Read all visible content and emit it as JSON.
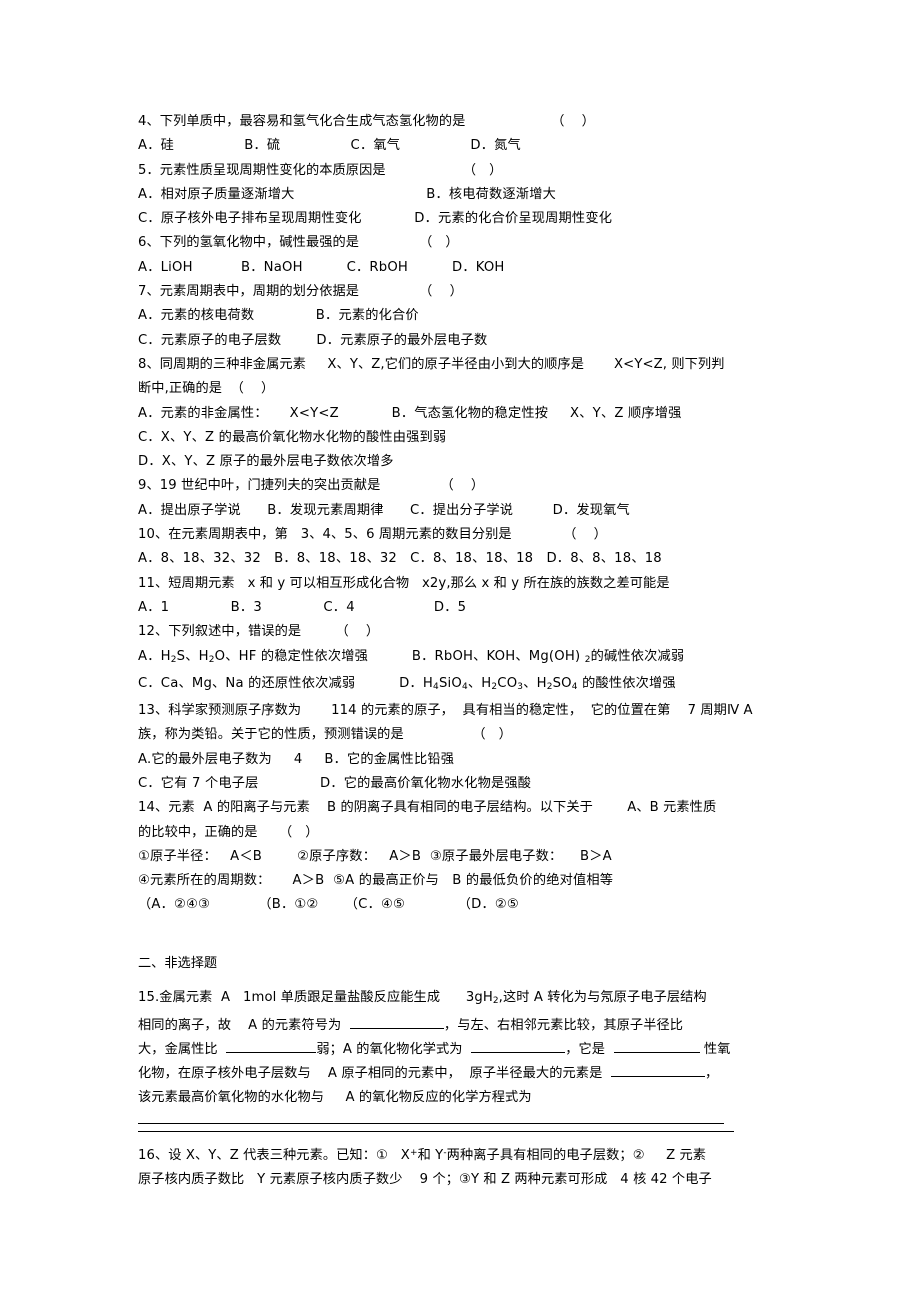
{
  "document": {
    "section_two_heading": "二、非选择题",
    "questions": [
      {
        "id": "q4",
        "stem": "4、下列单质中，最容易和氢气化合生成气态氢化物的是                    （    ）",
        "options": "A．硅                B．硫                C．氧气                D．氮气"
      },
      {
        "id": "q5",
        "stem": "5．元素性质呈现周期性变化的本质原因是                  （   ）",
        "option_a": "A．相对原子质量逐渐增大                              B．核电荷数逐渐增大",
        "option_c": "C．原子核外电子排布呈现周期性变化            D．元素的化合价呈现周期性变化"
      },
      {
        "id": "q6",
        "stem": "6、下列的氢氧化物中，碱性最强的是              （   ）",
        "options": "A．LiOH           B．NaOH          C．RbOH          D．KOH"
      },
      {
        "id": "q7",
        "stem": "7、元素周期表中，周期的划分依据是              （    ）",
        "option_a": "A．元素的核电荷数              B．元素的化合价",
        "option_c": "C．元素原子的电子层数        D．元素原子的最外层电子数"
      },
      {
        "id": "q8",
        "stem_line1": "8、同周期的三种非金属元素     X、Y、Z,它们的原子半径由小到大的顺序是       X<Y<Z, 则下列判",
        "stem_line2": "断中,正确的是  （    ）",
        "option_a": "A．元素的非金属性：     X<Y<Z            B．气态氢化物的稳定性按     X、Y、Z 顺序增强",
        "option_c": "C．X、Y、Z 的最高价氧化物水化物的酸性由强到弱",
        "option_d": "D．X、Y、Z 原子的最外层电子数依次增多"
      },
      {
        "id": "q9",
        "stem": "9、19 世纪中叶，门捷列夫的突出贡献是              （    ）",
        "options": "A．提出原子学说      B．发现元素周期律      C．提出分子学说         D．发现氧气"
      },
      {
        "id": "q10",
        "stem": "10、在元素周期表中，第   3、4、5、6 周期元素的数目分别是            （    ）",
        "options": "A．8、18、32、32   B．8、18、18、32   C．8、18、18、18   D．8、8、18、18"
      },
      {
        "id": "q11",
        "stem": "11、短周期元素   x 和 y 可以相互形成化合物   x2y,那么 x 和 y 所在族的族数之差可能是",
        "options": "A．1              B．3              C．4                  D．5"
      },
      {
        "id": "q12",
        "stem": "12、下列叙述中，错误的是        （    ）",
        "option_a_html": "A．H<sub>2</sub>S、H<sub>2</sub>O、HF 的稳定性依次增强          B．RbOH、KOH、Mg(OH) <sub>2</sub>的碱性依次减弱",
        "option_c_html": "C．Ca、Mg、Na 的还原性依次减弱          D．H<sub>4</sub>SiO<sub>4</sub>、H<sub>2</sub>CO<sub>3</sub>、H<sub>2</sub>SO<sub>4</sub> 的酸性依次增强"
      },
      {
        "id": "q13",
        "stem_line1": "13、科学家预测原子序数为       114 的元素的原子，  具有相当的稳定性，  它的位置在第    7 周期Ⅳ A",
        "stem_line2": "族，称为类铅。关于它的性质，预测错误的是                （   ）",
        "option_a": "A.它的最外层电子数为     4     B．它的金属性比铅强",
        "option_c": "C．它有 7 个电子层              D．它的最高价氧化物水化物是强酸"
      },
      {
        "id": "q14",
        "stem_line1": "14、元素  A 的阳离子与元素    B 的阴离子具有相同的电子层结构。以下关于        A、B 元素性质",
        "stem_line2": "的比较中，正确的是     （   ）",
        "statements_line1": "①原子半径：   A＜B        ②原子序数：   A＞B  ③原子最外层电子数：    B＞A",
        "statements_line2": "④元素所在的周期数：     A＞B  ⑤A 的最高正价与   B 的最低负价的绝对值相等",
        "answer_choices": "（A．②④③           （B．①②      （C．④⑤            （D．②⑤"
      }
    ],
    "q15": {
      "line1_pre": "15.金属元素  A   1mol 单质跟足量盐酸反应能生成      3gH",
      "line1_sub": "2",
      "line1_post": ",这时 A 转化为与氖原子电子层结构",
      "line2_pre": "相同的离子，故    A 的元素符号为  ",
      "line2_post": "，与左、右相邻元素比较，其原子半径比",
      "line3_pre": "大，金属性比  ",
      "line3_mid1": "弱；A 的氧化物化学式为  ",
      "line3_mid2": "，它是  ",
      "line3_post": " 性氧",
      "line4_pre": "化物，在原子核外电子层数与    A 原子相同的元素中，  原子半径最大的元素是  ",
      "line4_post": "，",
      "line5": "该元素最高价氧化物的水化物与     A 的氧化物反应的化学方程式为"
    },
    "q16": {
      "line1_pre": "16、设 X、Y、Z 代表三种元素。已知：①   X",
      "line1_sup1": "+",
      "line1_mid": "和 Y",
      "line1_sup2": "-",
      "line1_post": "两种离子具有相同的电子层数；②     Z 元素",
      "line2": "原子核内质子数比   Y 元素原子核内质子数少    9 个；③Y 和 Z 两种元素可形成   4 核 42 个电子"
    }
  }
}
